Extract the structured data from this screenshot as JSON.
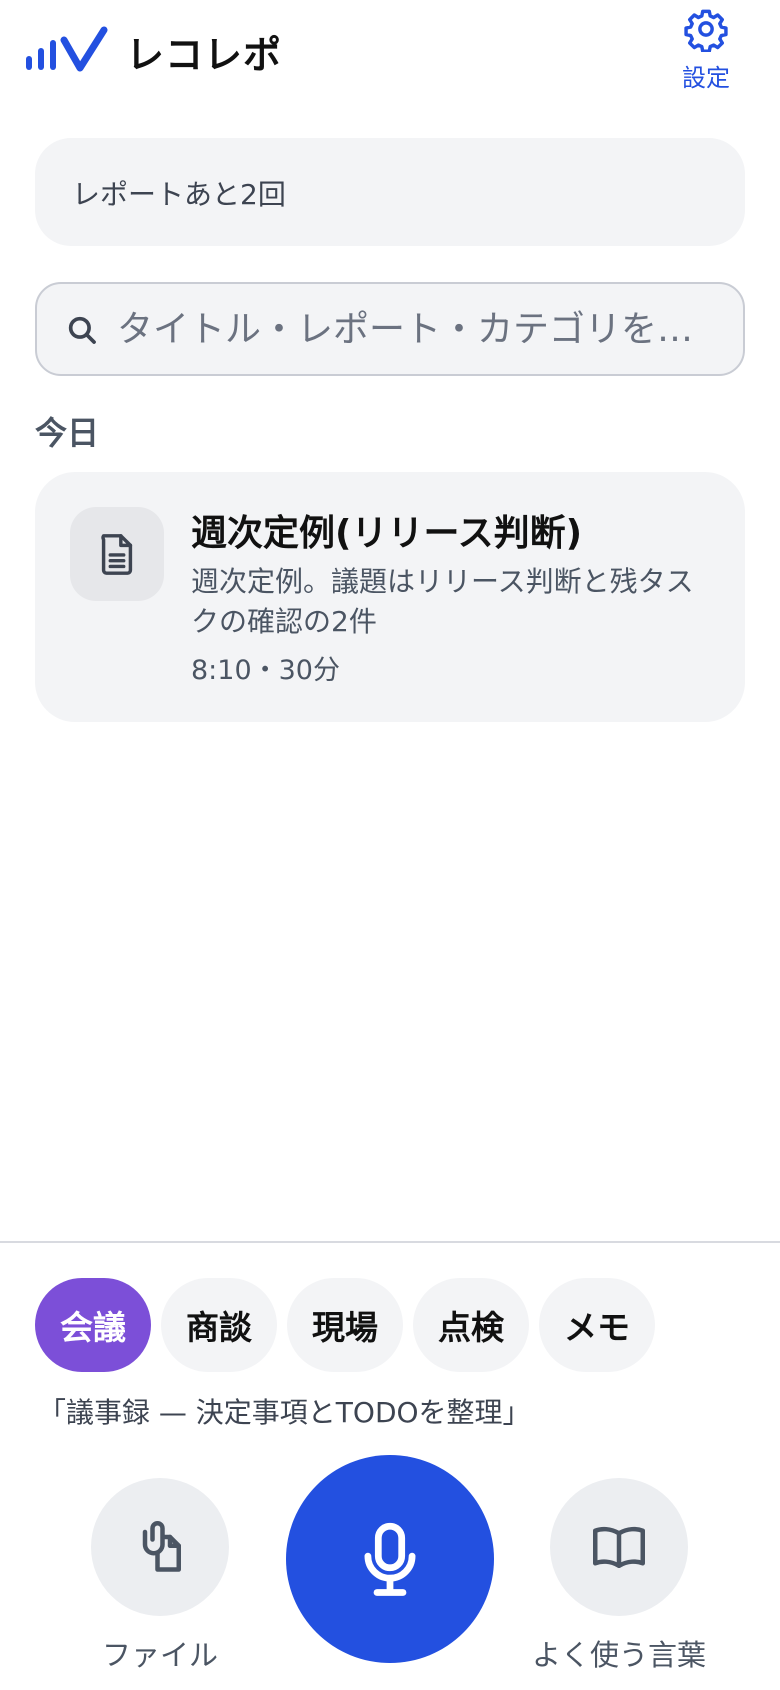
{
  "app": {
    "title": "レコレポ",
    "brand_color": "#2350e0",
    "logo_icon": "waveform-check-logo"
  },
  "header": {
    "settings_label": "設定",
    "settings_icon": "gear-icon"
  },
  "quota": {
    "text": "レポートあと2回"
  },
  "search": {
    "placeholder": "タイトル・レポート・カテゴリを…",
    "value": "",
    "icon": "search-icon"
  },
  "sections": {
    "today": "今日"
  },
  "reports": [
    {
      "title": "週次定例(リリース判断)",
      "summary": "週次定例。議題はリリース判断と残タスクの確認の2件",
      "meta": "8:10・30分",
      "icon": "document-icon"
    }
  ],
  "categories": {
    "items": [
      "会議",
      "商談",
      "現場",
      "点検",
      "メモ"
    ],
    "selected": "会議",
    "active_color": "#7c4fd8"
  },
  "template_hint": "「議事録 — 決定事項とTODOを整理」",
  "actions": {
    "file_label": "ファイル",
    "file_icon": "paperclip-file-icon",
    "record_icon": "microphone-icon",
    "phrases_label": "よく使う言葉",
    "phrases_icon": "open-book-icon"
  }
}
